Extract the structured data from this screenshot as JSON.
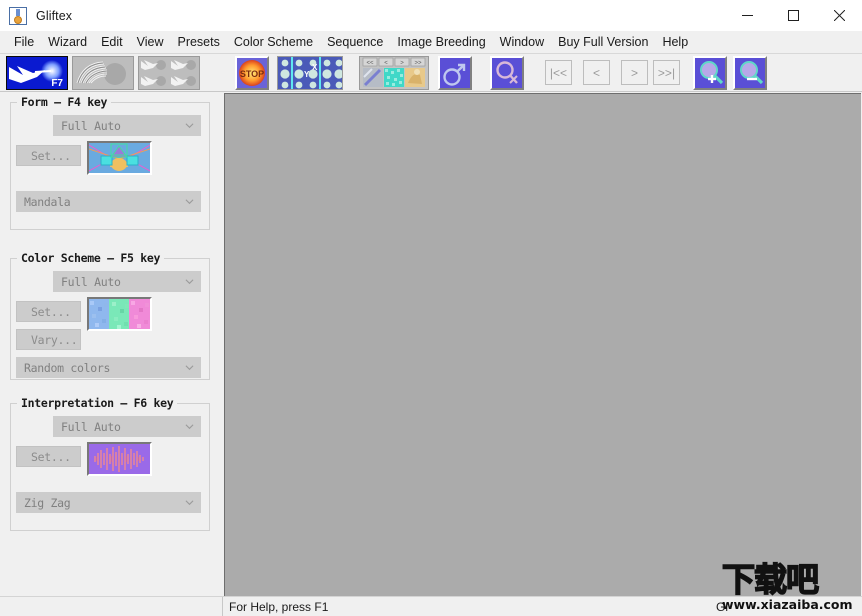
{
  "window": {
    "title": "Gliftex",
    "app_icon": "medal-icon",
    "controls": [
      {
        "name": "minimize",
        "glyph": "minimize-icon"
      },
      {
        "name": "maximize",
        "glyph": "maximize-icon"
      },
      {
        "name": "close",
        "glyph": "close-icon"
      }
    ]
  },
  "menubar": {
    "items": [
      {
        "label": "File",
        "name": "menu-file"
      },
      {
        "label": "Wizard",
        "name": "menu-wizard"
      },
      {
        "label": "Edit",
        "name": "menu-edit"
      },
      {
        "label": "View",
        "name": "menu-view"
      },
      {
        "label": "Presets",
        "name": "menu-presets"
      },
      {
        "label": "Color Scheme",
        "name": "menu-color-scheme"
      },
      {
        "label": "Sequence",
        "name": "menu-sequence"
      },
      {
        "label": "Image Breeding",
        "name": "menu-image-breeding"
      },
      {
        "label": "Window",
        "name": "menu-window"
      },
      {
        "label": "Buy Full Version",
        "name": "menu-buy-full-version"
      },
      {
        "label": "Help",
        "name": "menu-help"
      }
    ]
  },
  "toolbar": {
    "preview_selected_badge": "F7",
    "buttons": [
      {
        "name": "single-image-preview-button",
        "icon": "single-image-icon"
      },
      {
        "name": "fan-shapes-preview-button",
        "icon": "fan-shapes-icon"
      },
      {
        "name": "four-up-preview-button",
        "icon": "four-up-grid-icon"
      },
      {
        "name": "stop-button",
        "icon": "stop-icon",
        "label": "STOP"
      },
      {
        "name": "axes-overlay-button",
        "icon": "xy-axes-icon"
      },
      {
        "name": "sequence-strip-button",
        "icon": "sequence-strip-icon"
      },
      {
        "name": "male-breed-button",
        "icon": "mars-symbol-icon"
      },
      {
        "name": "female-breed-button",
        "icon": "venus-symbol-icon"
      },
      {
        "name": "zoom-in-button",
        "icon": "magnifier-plus-icon"
      },
      {
        "name": "zoom-out-button",
        "icon": "magnifier-minus-icon"
      }
    ],
    "nav_buttons": [
      {
        "name": "first-button",
        "label": "|<<"
      },
      {
        "name": "previous-button",
        "label": "<"
      },
      {
        "name": "next-button",
        "label": ">"
      },
      {
        "name": "last-button",
        "label": ">>|"
      }
    ],
    "strip_nav_labels": [
      "<<",
      "<",
      ">",
      ">>"
    ]
  },
  "sidebar": {
    "groups": [
      {
        "name": "form-group",
        "title": "Form — F4 key",
        "mode_value": "Full Auto",
        "set_label": "Set...",
        "type_value": "Mandala",
        "thumbnail": "form-preview-thumbnail"
      },
      {
        "name": "color-scheme-group",
        "title": "Color Scheme — F5 key",
        "mode_value": "Full Auto",
        "set_label": "Set...",
        "vary_label": "Vary...",
        "type_value": "Random colors",
        "thumbnail": "color-scheme-preview-thumbnail"
      },
      {
        "name": "interpretation-group",
        "title": "Interpretation — F6 key",
        "mode_value": "Full Auto",
        "set_label": "Set...",
        "type_value": "Zig Zag",
        "thumbnail": "interpretation-preview-thumbnail"
      }
    ]
  },
  "statusbar": {
    "help_text": "For Help, press F1",
    "right_text": "Gl"
  },
  "watermark": {
    "characters": "下载吧",
    "url": "www.xiazaiba.com"
  },
  "colors": {
    "window_bg": "#f0f0f0",
    "canvas_bg": "#ababab",
    "control_face": "#cccccc",
    "disabled_text": "#808080",
    "icon_purple": "#5a4fd6",
    "selection_border": "#0a0a0a"
  }
}
